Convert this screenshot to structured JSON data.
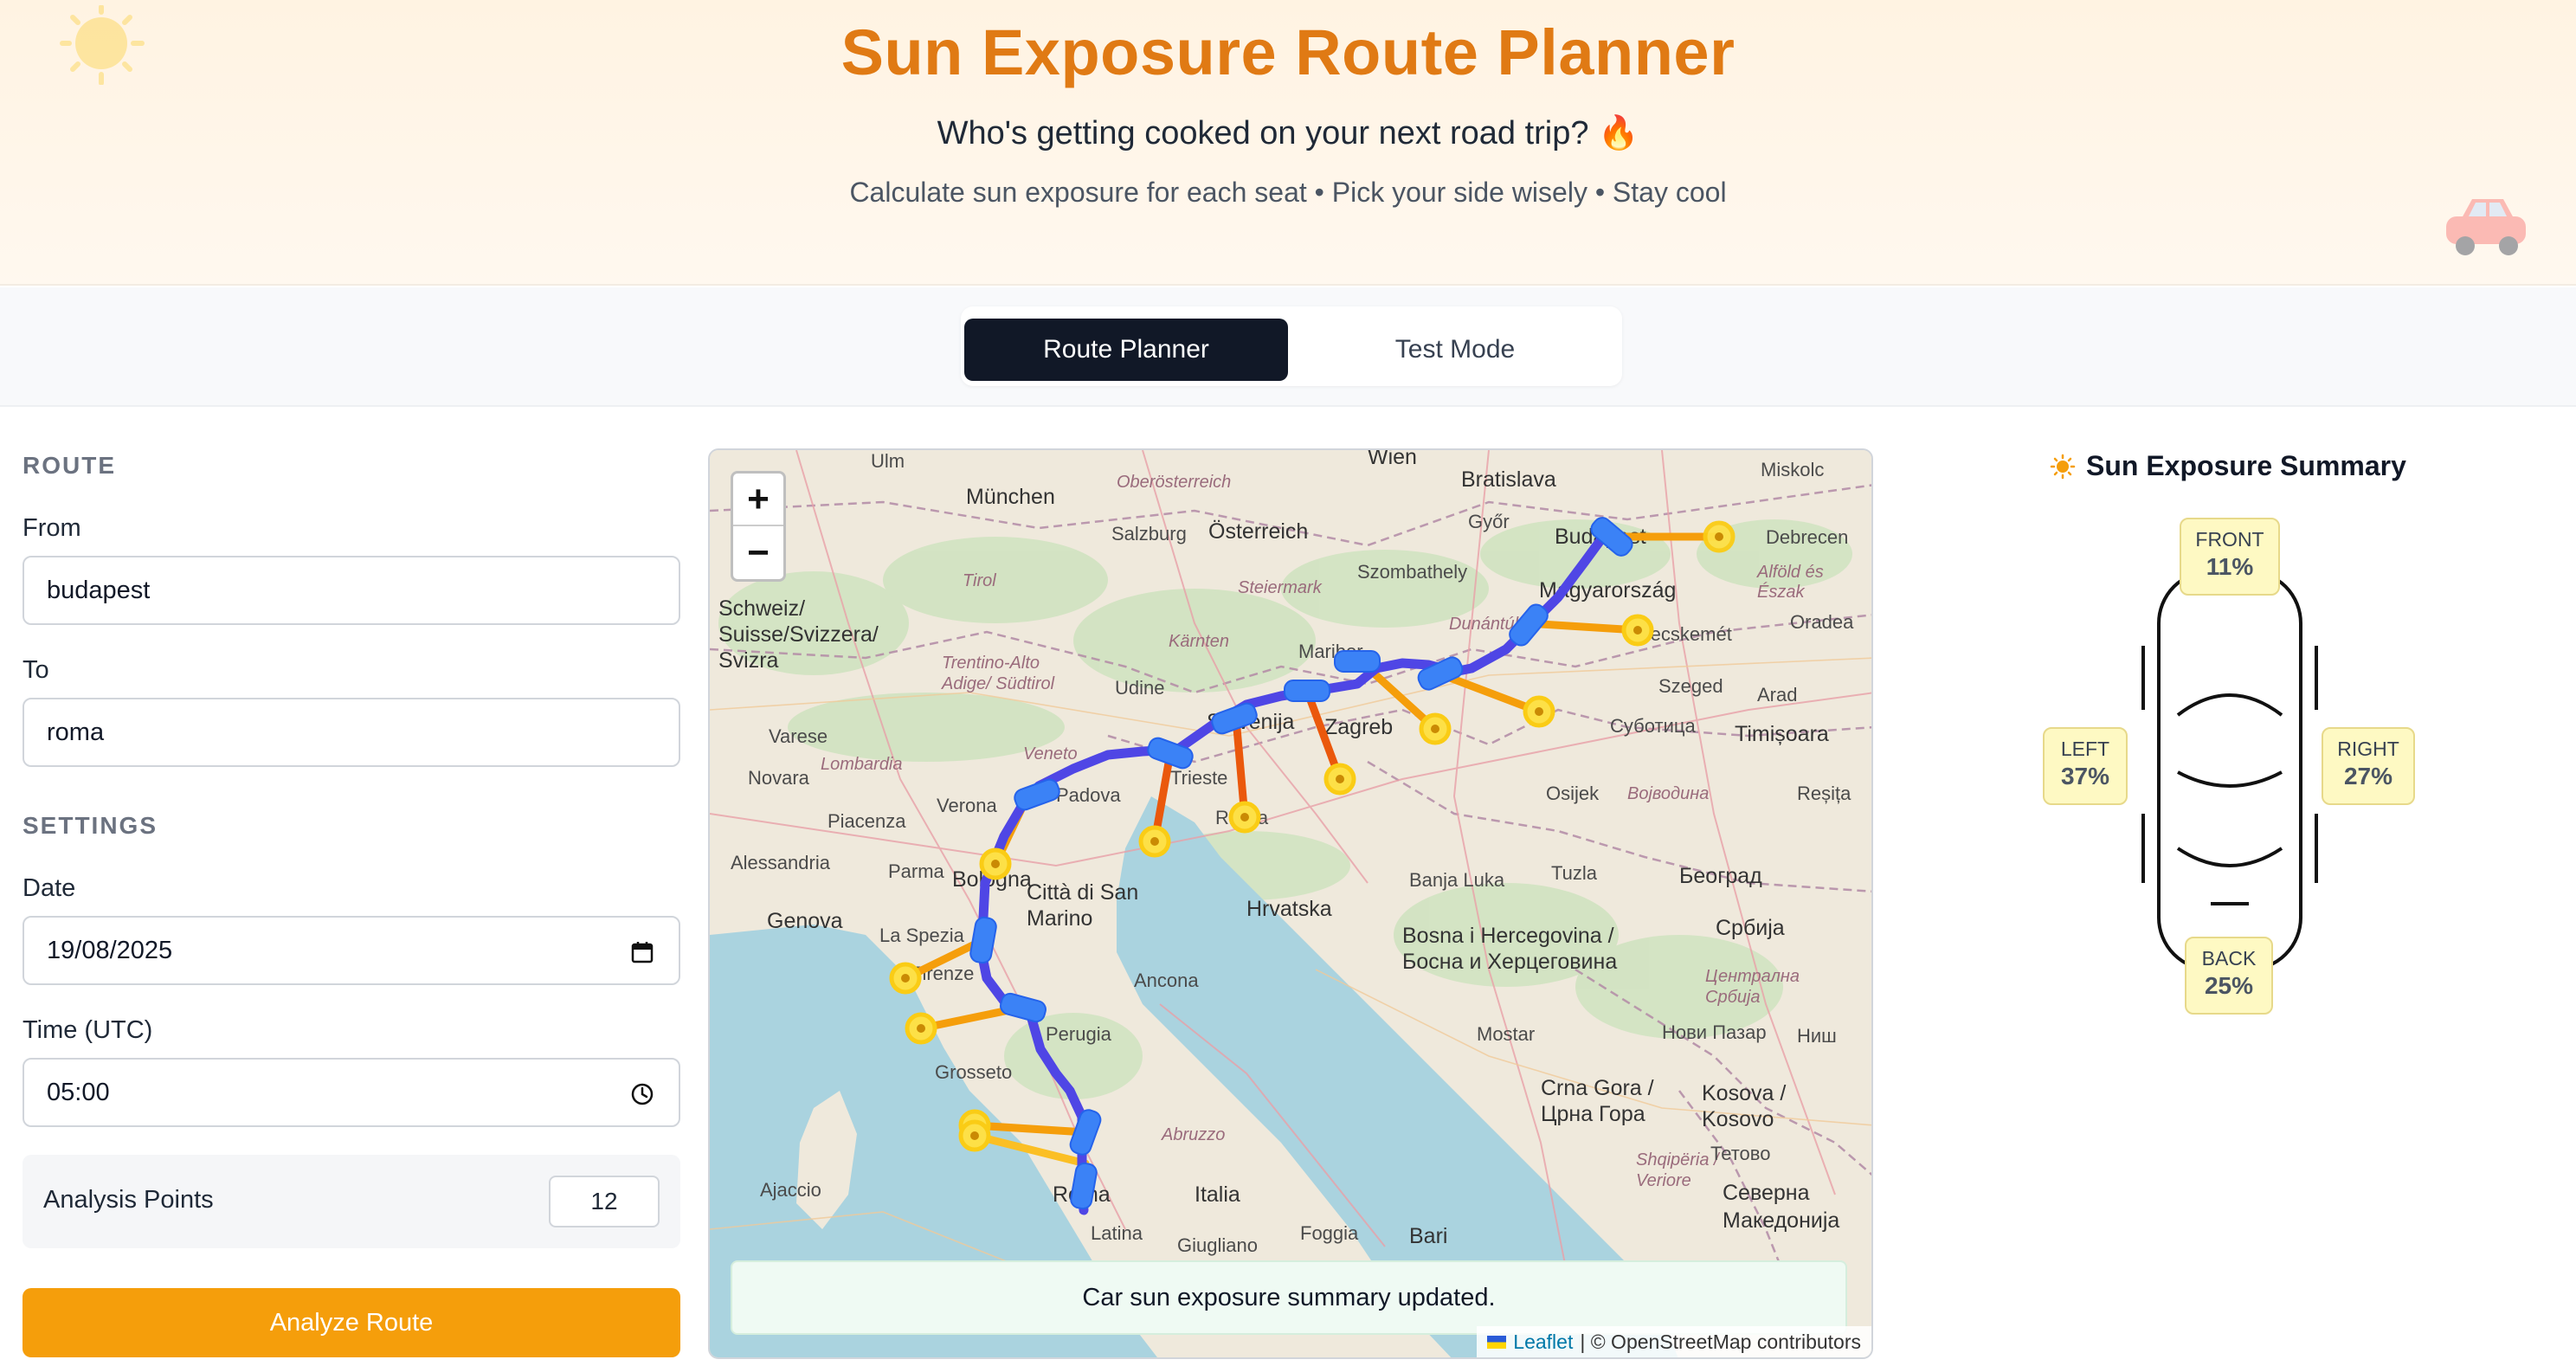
{
  "header": {
    "title": "Sun Exposure Route Planner",
    "subtitle": "Who's getting cooked on your next road trip? 🔥",
    "tagline": "Calculate sun exposure for each seat • Pick your side wisely • Stay cool"
  },
  "tabs": {
    "route_planner": "Route Planner",
    "test_mode": "Test Mode",
    "active": "route_planner"
  },
  "route": {
    "section_title": "ROUTE",
    "from_label": "From",
    "from_value": "budapest",
    "to_label": "To",
    "to_value": "roma"
  },
  "settings": {
    "section_title": "SETTINGS",
    "date_label": "Date",
    "date_value": "19/08/2025",
    "time_label": "Time (UTC)",
    "time_value": "05:00",
    "analysis_label": "Analysis Points",
    "analysis_value": "12"
  },
  "analyze_button": "Analyze Route",
  "map": {
    "zoom_in": "+",
    "zoom_out": "−",
    "toast": "Car sun exposure summary updated.",
    "attribution_leaflet": "Leaflet",
    "attribution_rest": "| © OpenStreetMap contributors",
    "route_color": "#4f46e5",
    "sun_line_colors": [
      "#f97316",
      "#fbbf24",
      "#ea580c"
    ],
    "labels": {
      "wien": "Wien",
      "bratislava": "Bratislava",
      "miskolc": "Miskolc",
      "ulm": "Ulm",
      "munchen": "München",
      "oberosterreich": "Oberösterreich",
      "salzburg": "Salzburg",
      "osterreich": "Österreich",
      "gyor": "Győr",
      "budapest": "Budapest",
      "debrecen": "Debrecen",
      "tirol": "Tirol",
      "steiermark": "Steiermark",
      "szombathely": "Szombathely",
      "magyarorszag": "Magyarország",
      "alfold": "Alföld és Észak",
      "oradea": "Oradea",
      "schweiz": "Schweiz/ Suisse/Svizzera/ Svizra",
      "karnten": "Kärnten",
      "dunantul": "Dunántúl",
      "kecskemet": "Kecskemét",
      "trentino": "Trentino-Alto Adige/ Südtirol",
      "udine": "Udine",
      "maribor": "Maribor",
      "szeged": "Szeged",
      "arad": "Arad",
      "varese": "Varese",
      "slovenija": "Slovenija",
      "zagreb": "Zagreb",
      "subotica": "Суботица",
      "timisoara": "Timișoara",
      "novara": "Novara",
      "lombardia": "Lombardia",
      "veneto": "Veneto",
      "trieste": "Trieste",
      "padova": "Padova",
      "verona": "Verona",
      "rijeka": "Rijeka",
      "osijek": "Osijek",
      "vojvodina": "Војводина",
      "resita": "Reșița",
      "piacenza": "Piacenza",
      "alessandria": "Alessandria",
      "parma": "Parma",
      "bologna": "Bologna",
      "banjaluka": "Banja Luka",
      "tuzla": "Tuzla",
      "beograd": "Београд",
      "genova": "Genova",
      "cittadisanmarino": "Città di San Marino",
      "hrvatska": "Hrvatska",
      "srbija": "Србија",
      "laspezia": "La Spezia",
      "firenze": "Firenze",
      "bih": "Bosna i Hercegovina / Босна и Херцеговина",
      "centralna": "Централна Србија",
      "ancona": "Ancona",
      "perugia": "Perugia",
      "mostar": "Mostar",
      "nis": "Ниш",
      "novipazar": "Нови Пазар",
      "grosseto": "Grosseto",
      "crnagora": "Crna Gora / Црна Гора",
      "kosova": "Kosova / Kosovo",
      "abruzzo": "Abruzzo",
      "shqiperia": "Shqipëria / Veriore",
      "tetovo": "Тетово",
      "ajaccio": "Ajaccio",
      "roma": "Roma",
      "italia": "Italia",
      "severna": "Северна Македонија",
      "latina": "Latina",
      "foggia": "Foggia",
      "bari": "Bari",
      "giugliano": "Giugliano"
    }
  },
  "summary": {
    "title": "Sun Exposure Summary",
    "front_label": "FRONT",
    "front_value": "11%",
    "left_label": "LEFT",
    "left_value": "37%",
    "right_label": "RIGHT",
    "right_value": "27%",
    "back_label": "BACK",
    "back_value": "25%"
  }
}
